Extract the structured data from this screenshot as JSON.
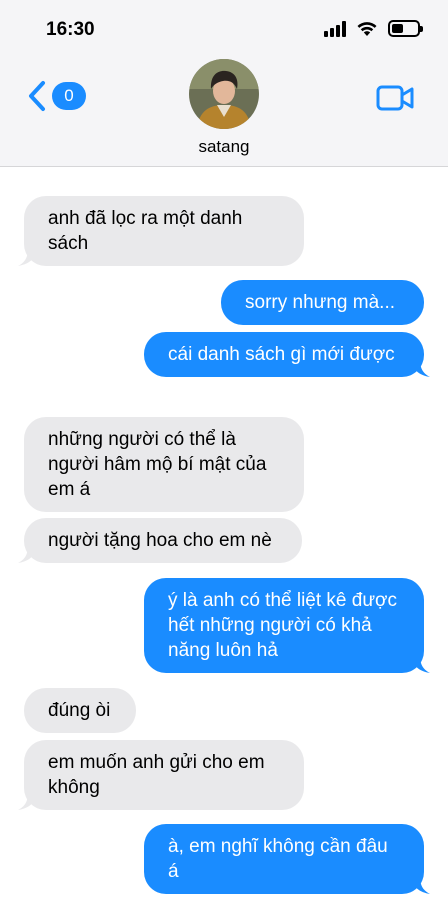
{
  "status_bar": {
    "time": "16:30",
    "battery_level": 0.45
  },
  "header": {
    "unread_count": "0",
    "contact_name": "satang"
  },
  "colors": {
    "outgoing": "#1a8cff",
    "incoming": "#e9e9eb",
    "header_bg": "#f5f5f7"
  },
  "icons": {
    "back": "chevron-left-icon",
    "video": "video-camera-icon",
    "wifi": "wifi-icon",
    "signal": "cellular-signal-icon",
    "battery": "battery-icon"
  },
  "messages": [
    {
      "dir": "in",
      "text": "anh đã lọc ra một danh sách"
    },
    {
      "dir": "out",
      "text": "sorry nhưng mà..."
    },
    {
      "dir": "out",
      "text": "cái danh sách gì mới được"
    },
    {
      "dir": "in",
      "text": "những người có thể là người hâm mộ bí mật của em á"
    },
    {
      "dir": "in",
      "text": "người tặng hoa cho em nè"
    },
    {
      "dir": "out",
      "text": "ý là anh có thể liệt kê được hết những người có khả năng luôn hả"
    },
    {
      "dir": "in",
      "text": "đúng òi"
    },
    {
      "dir": "in",
      "text": "em muốn anh gửi cho em không"
    },
    {
      "dir": "out",
      "text": "à, em nghĩ không cần đâu á"
    }
  ]
}
